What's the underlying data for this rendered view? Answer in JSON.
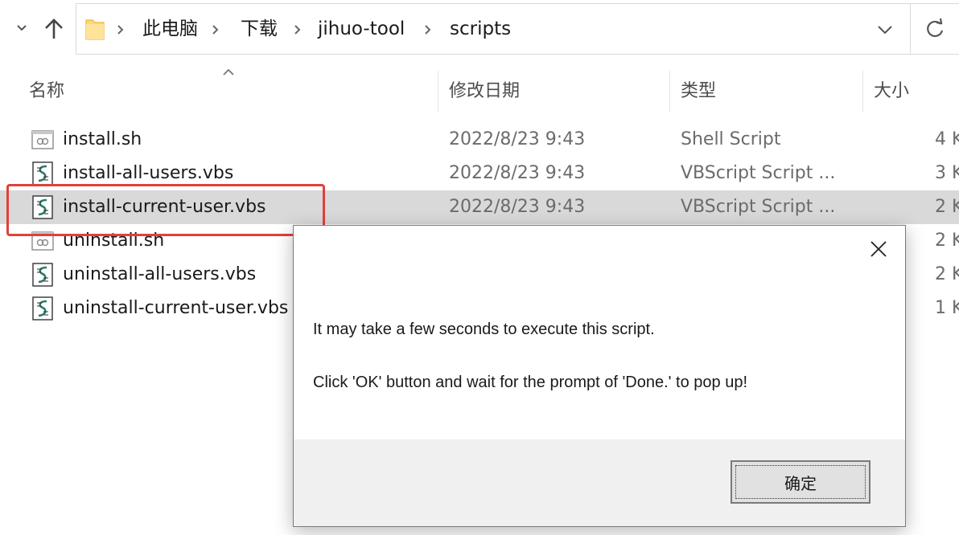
{
  "address_bar": {
    "breadcrumbs": [
      "此电脑",
      "下载",
      "jihuo-tool",
      "scripts"
    ],
    "icons": [
      "recent-locations-icon",
      "up-arrow-icon",
      "folder-icon",
      "chevron-right-icon",
      "chevron-down-icon",
      "refresh-icon"
    ]
  },
  "columns": {
    "name": "名称",
    "date_modified": "修改日期",
    "type": "类型",
    "size": "大小"
  },
  "files": [
    {
      "name": "install.sh",
      "date": "2022/8/23 9:43",
      "type": "Shell Script",
      "size": "4 K",
      "icon": "shell-script-icon"
    },
    {
      "name": "install-all-users.vbs",
      "date": "2022/8/23 9:43",
      "type": "VBScript Script ...",
      "size": "3 K",
      "icon": "vbscript-icon"
    },
    {
      "name": "install-current-user.vbs",
      "date": "2022/8/23 9:43",
      "type": "VBScript Script ...",
      "size": "2 K",
      "icon": "vbscript-icon",
      "selected": true
    },
    {
      "name": "uninstall.sh",
      "date": "",
      "type": "",
      "size": "2 K",
      "icon": "shell-script-icon"
    },
    {
      "name": "uninstall-all-users.vbs",
      "date": "",
      "type": "",
      "size": "2 K",
      "icon": "vbscript-icon"
    },
    {
      "name": "uninstall-current-user.vbs",
      "date": "",
      "type": "",
      "size": "1 K",
      "icon": "vbscript-icon"
    }
  ],
  "dialog": {
    "message_line1": "It may take a few seconds to execute this script.",
    "message_line2": "Click 'OK' button and wait for the prompt of 'Done.' to pop up!",
    "ok_label": "确定"
  },
  "colors": {
    "highlight": "#e0413b",
    "selected_row": "#d9d9d9",
    "dialog_footer": "#f0f0f0"
  }
}
